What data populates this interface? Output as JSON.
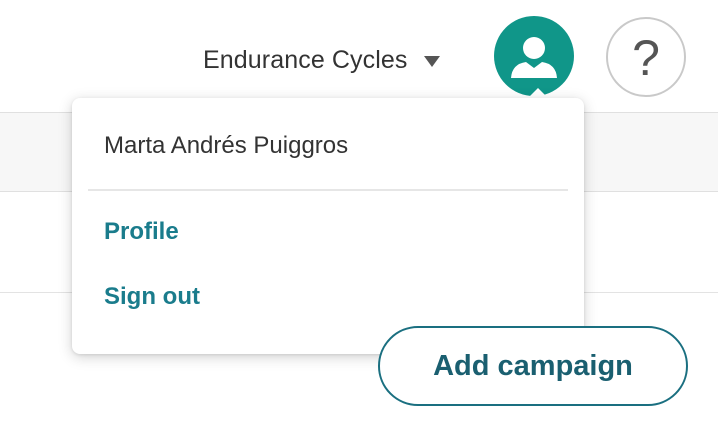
{
  "header": {
    "org_name": "Endurance Cycles",
    "caret_icon": "caret-down-icon",
    "avatar_icon": "user-avatar-icon",
    "help_label": "?"
  },
  "user_menu": {
    "user_name": "Marta Andrés Puiggros",
    "items": [
      {
        "label": "Profile"
      },
      {
        "label": "Sign out"
      }
    ]
  },
  "main": {
    "add_campaign_label": "Add campaign"
  },
  "colors": {
    "accent": "#109689",
    "link": "#1a7c8c",
    "button_border": "#1a6f80"
  }
}
